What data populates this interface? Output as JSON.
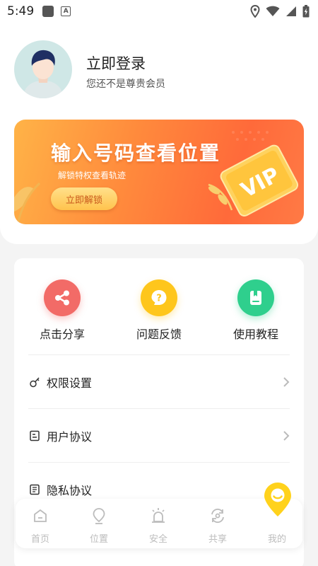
{
  "status": {
    "time": "5:49"
  },
  "profile": {
    "login_title": "立即登录",
    "login_subtitle": "您还不是尊贵会员"
  },
  "banner": {
    "title": "输入号码查看位置",
    "subtitle": "解锁特权查看轨迹",
    "button_label": "立即解锁",
    "badge_text": "VIP"
  },
  "quick_actions": [
    {
      "label": "点击分享",
      "icon": "share-icon",
      "color": "#f26b67"
    },
    {
      "label": "问题反馈",
      "icon": "question-icon",
      "color": "#fec61c"
    },
    {
      "label": "使用教程",
      "icon": "book-icon",
      "color": "#2fcf8d"
    }
  ],
  "menu": [
    {
      "label": "权限设置",
      "icon": "key-icon"
    },
    {
      "label": "用户协议",
      "icon": "document-icon"
    },
    {
      "label": "隐私协议",
      "icon": "document-lines-icon"
    }
  ],
  "bottom_nav": [
    {
      "label": "首页",
      "icon": "home-icon"
    },
    {
      "label": "位置",
      "icon": "location-pin-icon"
    },
    {
      "label": "安全",
      "icon": "alarm-icon"
    },
    {
      "label": "共享",
      "icon": "share-sync-icon"
    },
    {
      "label": "我的",
      "icon": "profile-icon",
      "selected": true
    }
  ],
  "colors": {
    "accent_orange": "#ff7a3d",
    "fab_yellow": "#ffd21c",
    "nav_inactive": "#bcbcbc"
  }
}
